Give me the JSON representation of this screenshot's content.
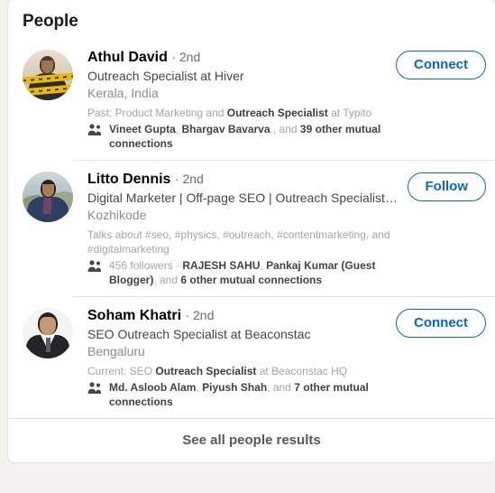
{
  "section": {
    "title": "People",
    "see_all_label": "See all people results"
  },
  "icons": {
    "mutual": "people-icon"
  },
  "colors": {
    "accent": "#0a66c2",
    "page_background": "#f3f2ef",
    "card_background": "#ffffff",
    "divider": "#e6e4e1"
  },
  "people": [
    {
      "name": "Athul David",
      "degree": "· 2nd",
      "headline": "Outreach Specialist at Hiver",
      "location": "Kerala, India",
      "meta_prefix": "Past: Product Marketing and ",
      "meta_bold": "Outreach Specialist",
      "meta_suffix": " at Typito",
      "mutual_pre": "",
      "mutual_bold_1": "Vineet Gupta",
      "mutual_sep_1": ", ",
      "mutual_bold_2": "Bhargav Bavarva",
      "mutual_sep_2": " , and ",
      "mutual_bold_3": "39 other mutual connections",
      "action_label": "Connect"
    },
    {
      "name": "Litto Dennis",
      "degree": "· 2nd",
      "headline": "Digital Marketer | Off-page SEO | Outreach Specialist | @…",
      "location": "Kozhikode",
      "meta_prefix": "Talks about #seo, #physics, #outreach, #contentmarketing, and #digitalmarketing",
      "meta_bold": "",
      "meta_suffix": "",
      "mutual_pre": "456 followers · ",
      "mutual_bold_1": "RAJESH SAHU",
      "mutual_sep_1": ", ",
      "mutual_bold_2": "Pankaj Kumar (Guest Blogger)",
      "mutual_sep_2": ", and ",
      "mutual_bold_3": "6 other mutual connections",
      "action_label": "Follow"
    },
    {
      "name": "Soham Khatri",
      "degree": "· 2nd",
      "headline": "SEO Outreach Specialist at Beaconstac",
      "location": "Bengaluru",
      "meta_prefix": "Current: SEO ",
      "meta_bold": "Outreach Specialist",
      "meta_suffix": " at Beaconstac HQ",
      "mutual_pre": "",
      "mutual_bold_1": "Md. Asloob Alam",
      "mutual_sep_1": ", ",
      "mutual_bold_2": "Piyush Shah",
      "mutual_sep_2": ", and ",
      "mutual_bold_3": "7 other mutual connections",
      "action_label": "Connect"
    }
  ]
}
